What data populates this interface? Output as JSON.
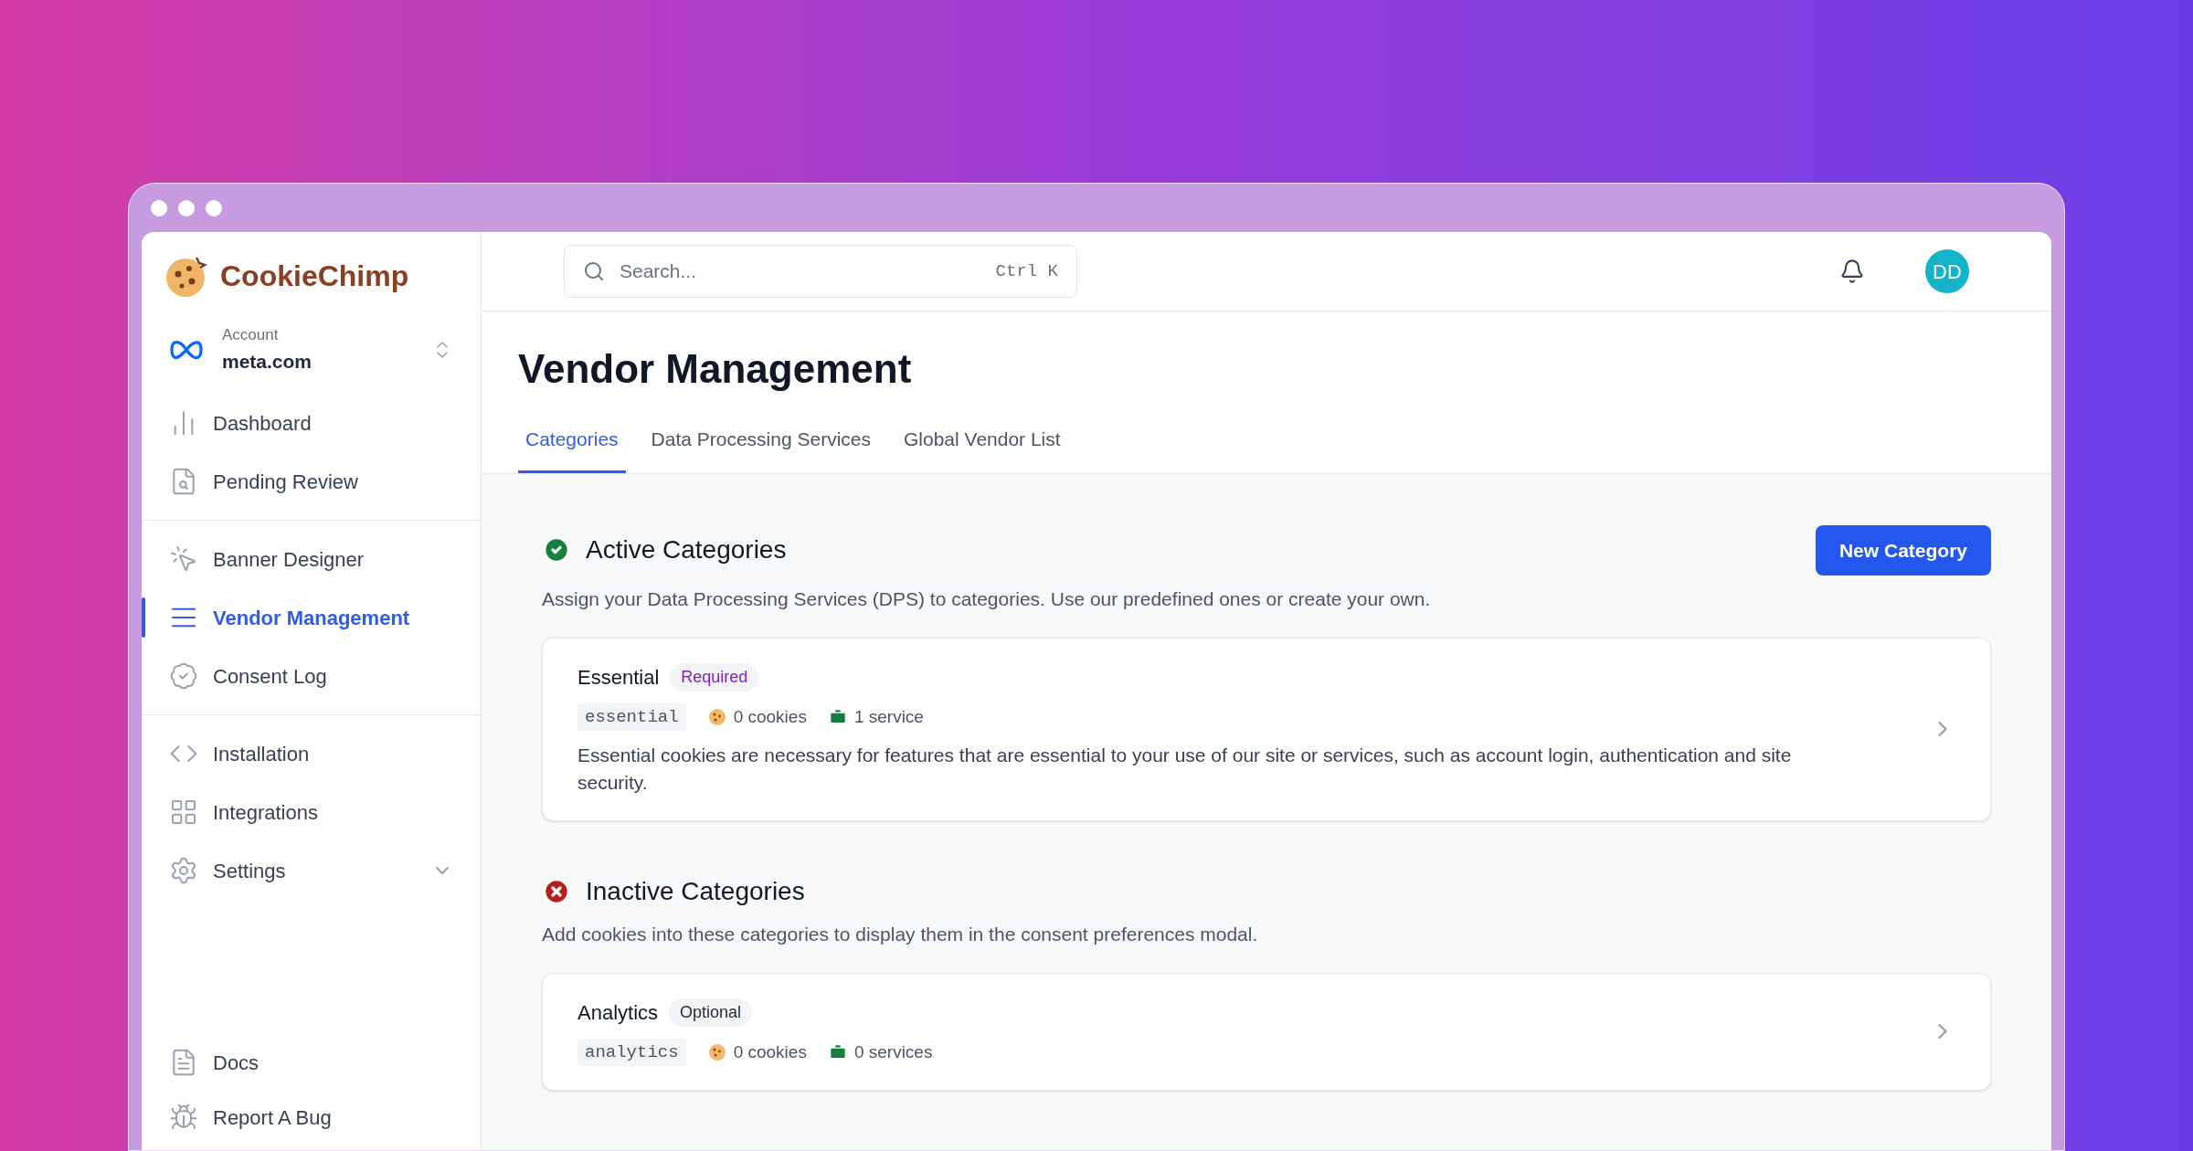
{
  "brand": {
    "name": "CookieChimp"
  },
  "account": {
    "label": "Account",
    "value": "meta.com"
  },
  "sidebar": {
    "groups": [
      [
        {
          "label": "Dashboard",
          "selected": false
        },
        {
          "label": "Pending Review",
          "selected": false
        }
      ],
      [
        {
          "label": "Banner Designer",
          "selected": false
        },
        {
          "label": "Vendor Management",
          "selected": true
        },
        {
          "label": "Consent Log",
          "selected": false
        }
      ],
      [
        {
          "label": "Installation",
          "selected": false
        },
        {
          "label": "Integrations",
          "selected": false
        },
        {
          "label": "Settings",
          "selected": false,
          "expanded": false
        }
      ]
    ],
    "bottom": [
      {
        "label": "Docs"
      },
      {
        "label": "Report A Bug"
      }
    ]
  },
  "search": {
    "placeholder": "Search...",
    "shortcut": "Ctrl K"
  },
  "user": {
    "initials": "DD"
  },
  "page": {
    "title": "Vendor Management"
  },
  "tabs": [
    {
      "label": "Categories",
      "selected": true
    },
    {
      "label": "Data Processing Services",
      "selected": false
    },
    {
      "label": "Global Vendor List",
      "selected": false
    }
  ],
  "sections": [
    {
      "kind": "active",
      "title": "Active Categories",
      "description": "Assign your Data Processing Services (DPS) to categories. Use our predefined ones or create your own.",
      "action": "New Category",
      "categories": [
        {
          "name": "Essential",
          "badge": "Required",
          "color": "#7e22ce",
          "slug": "essential",
          "cookies": "0 cookies",
          "services": "1 service",
          "description": "Essential cookies are necessary for features that are essential to your use of our site or services, such as account login, authentication and site security."
        }
      ]
    },
    {
      "kind": "inactive",
      "title": "Inactive Categories",
      "description": "Add cookies into these categories to display them in the consent preferences modal.",
      "categories": [
        {
          "name": "Analytics",
          "badge": "Optional",
          "color": "#1f2937",
          "slug": "analytics",
          "cookies": "0 cookies",
          "services": "0 services"
        }
      ]
    }
  ]
}
